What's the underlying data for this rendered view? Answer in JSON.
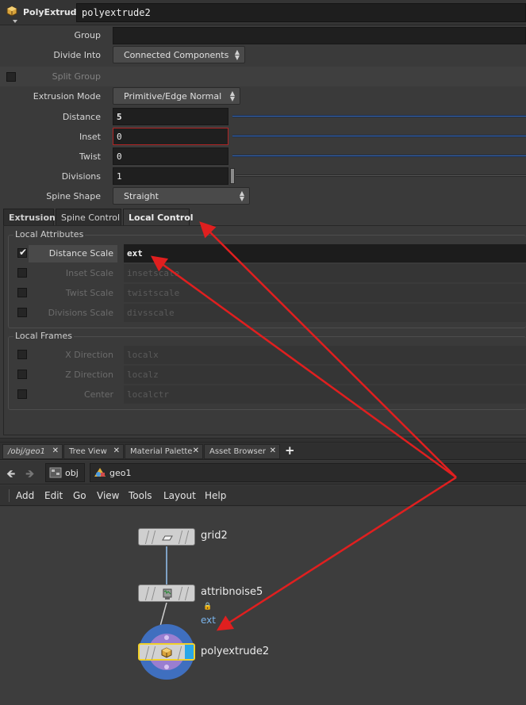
{
  "header": {
    "node_type": "PolyExtrude",
    "node_name": "polyextrude2"
  },
  "parms": {
    "group": {
      "label": "Group",
      "value": ""
    },
    "divide_into": {
      "label": "Divide Into",
      "value": "Connected Components"
    },
    "split_group": {
      "label": "Split Group",
      "checked": false
    },
    "extrusion_mode": {
      "label": "Extrusion Mode",
      "value": "Primitive/Edge Normal"
    },
    "distance": {
      "label": "Distance",
      "value": "5"
    },
    "inset": {
      "label": "Inset",
      "value": "0"
    },
    "twist": {
      "label": "Twist",
      "value": "0"
    },
    "divisions": {
      "label": "Divisions",
      "value": "1"
    },
    "spine_shape": {
      "label": "Spine Shape",
      "value": "Straight"
    }
  },
  "tabs": [
    "Extrusion",
    "Spine Control",
    "Local Control"
  ],
  "active_tab": "Local Control",
  "local_attributes": {
    "title": "Local Attributes",
    "rows": [
      {
        "label": "Distance Scale",
        "value": "ext",
        "checked": true
      },
      {
        "label": "Inset Scale",
        "value": "insetscale",
        "checked": false
      },
      {
        "label": "Twist Scale",
        "value": "twistscale",
        "checked": false
      },
      {
        "label": "Divisions Scale",
        "value": "divsscale",
        "checked": false
      }
    ]
  },
  "local_frames": {
    "title": "Local Frames",
    "rows": [
      {
        "label": "X Direction",
        "value": "localx",
        "checked": false
      },
      {
        "label": "Z Direction",
        "value": "localz",
        "checked": false
      },
      {
        "label": "Center",
        "value": "localctr",
        "checked": false
      }
    ]
  },
  "pane_tabs": [
    "/obj/geo1",
    "Tree View",
    "Material Palette",
    "Asset Browser"
  ],
  "pane_tab_add": "+",
  "path": {
    "obj": "obj",
    "geo": "geo1"
  },
  "menubar": [
    "Add",
    "Edit",
    "Go",
    "View",
    "Tools",
    "Layout",
    "Help"
  ],
  "nodes": [
    {
      "name": "grid2",
      "icon": "grid-icon"
    },
    {
      "name": "attribnoise5",
      "icon": "attribnoise-icon",
      "badge": "ext"
    },
    {
      "name": "polyextrude2",
      "icon": "polyextrude-icon"
    }
  ],
  "colors": {
    "annotation_red": "#e01f1f",
    "slider_blue": "#3b66a8",
    "selected_outline": "#f2d12a",
    "display_flag": "#2aa7e8",
    "badge_blue": "#7ab3ea"
  }
}
